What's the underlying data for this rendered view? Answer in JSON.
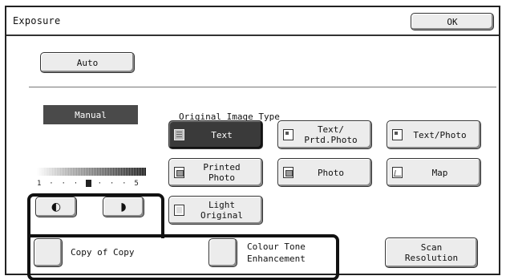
{
  "window": {
    "title": "Exposure",
    "ok_label": "OK"
  },
  "mode": {
    "auto_label": "Auto",
    "manual_label": "Manual"
  },
  "original_image_type": {
    "heading": "Original Image Type",
    "buttons": [
      {
        "label": "Text",
        "icon": "text-document-icon",
        "selected": true
      },
      {
        "label": "Text/\nPrtd.Photo",
        "icon": "text-printed-photo-icon",
        "selected": false
      },
      {
        "label": "Text/Photo",
        "icon": "text-photo-icon",
        "selected": false
      },
      {
        "label": "Printed\nPhoto",
        "icon": "printed-photo-icon",
        "selected": false
      },
      {
        "label": "Photo",
        "icon": "photo-icon",
        "selected": false
      },
      {
        "label": "Map",
        "icon": "map-icon",
        "selected": false
      },
      {
        "label": "Light\nOriginal",
        "icon": "light-original-icon",
        "selected": false
      }
    ]
  },
  "exposure_scale": {
    "left_mark": "1",
    "right_mark": "5",
    "level": 3,
    "lighter_icon": "lighter-half-circle-icon",
    "darker_icon": "darker-half-circle-icon"
  },
  "options": {
    "copy_of_copy": "Copy of Copy",
    "colour_tone": "Colour Tone\nEnhancement",
    "scan_resolution": "Scan\nResolution"
  }
}
